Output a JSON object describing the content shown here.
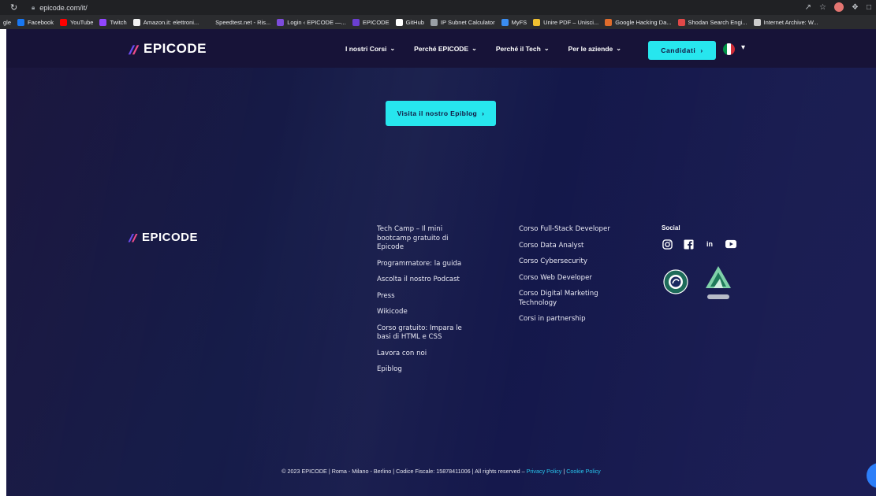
{
  "browser": {
    "url": "epicode.com/it/",
    "bookmarks": [
      {
        "label": "gle",
        "icon": "google-icon",
        "color": "#4285f4"
      },
      {
        "label": "Facebook",
        "icon": "facebook-icon",
        "color": "#1877f2"
      },
      {
        "label": "YouTube",
        "icon": "youtube-icon",
        "color": "#ff0000"
      },
      {
        "label": "Twitch",
        "icon": "twitch-icon",
        "color": "#9146ff"
      },
      {
        "label": "Amazon.it: elettroni...",
        "icon": "amazon-icon",
        "color": "#f2f2f2"
      },
      {
        "label": "Speedtest.net - Ris...",
        "icon": "speedtest-icon",
        "color": "#2b2c2f"
      },
      {
        "label": "Login ‹ EPICODE —...",
        "icon": "epicode-icon",
        "color": "#7d4cdb"
      },
      {
        "label": "EPICODE",
        "icon": "epicode-icon",
        "color": "#6a3fd0"
      },
      {
        "label": "GitHub",
        "icon": "github-icon",
        "color": "#ffffff"
      },
      {
        "label": "IP Subnet Calculator",
        "icon": "calculator-icon",
        "color": "#9aa0a6"
      },
      {
        "label": "MyFS",
        "icon": "myfs-icon",
        "color": "#3a8cf0"
      },
      {
        "label": "Unire PDF – Unisci...",
        "icon": "pdf-icon",
        "color": "#f0c030"
      },
      {
        "label": "Google Hacking Da...",
        "icon": "exploit-icon",
        "color": "#e06c2c"
      },
      {
        "label": "Shodan Search Engi...",
        "icon": "shodan-icon",
        "color": "#e04848"
      },
      {
        "label": "Internet Archive: W...",
        "icon": "archive-icon",
        "color": "#cccccc"
      }
    ]
  },
  "nav": {
    "logo": "EPICODE",
    "links": [
      "I nostri Corsi",
      "Perché EPICODE",
      "Perché il Tech",
      "Per le aziende"
    ],
    "cta": "Candidati"
  },
  "hero": {
    "blog_button": "Visita il nostro Epiblog"
  },
  "footer": {
    "logo": "EPICODE",
    "col1": [
      "Tech Camp – Il mini bootcamp gratuito di Epicode",
      "Programmatore: la guida",
      "Ascolta il nostro Podcast",
      "Press",
      "Wikicode",
      "Corso gratuito: Impara le basi di HTML e CSS",
      "Lavora con noi",
      "Epiblog"
    ],
    "col2": [
      "Corso Full-Stack Developer",
      "Corso Data Analyst",
      "Corso Cybersecurity",
      "Corso Web Developer",
      "Corso Digital Marketing Technology",
      "Corsi in partnership"
    ],
    "social_title": "Social",
    "social_icons": [
      "instagram-icon",
      "facebook-icon",
      "linkedin-icon",
      "youtube-icon"
    ],
    "badges": [
      "accredia-badge",
      "act-badge"
    ],
    "copyright_main": "© 2023 EPICODE | Roma - Milano - Berlino | Codice Fiscale: 15878411006 | All rights reserved –",
    "privacy": "Privacy Policy",
    "separator": "|",
    "cookie": "Cookie Policy"
  },
  "colors": {
    "accent": "#27e6ee",
    "background": "#161c49",
    "nav": "#171338"
  }
}
